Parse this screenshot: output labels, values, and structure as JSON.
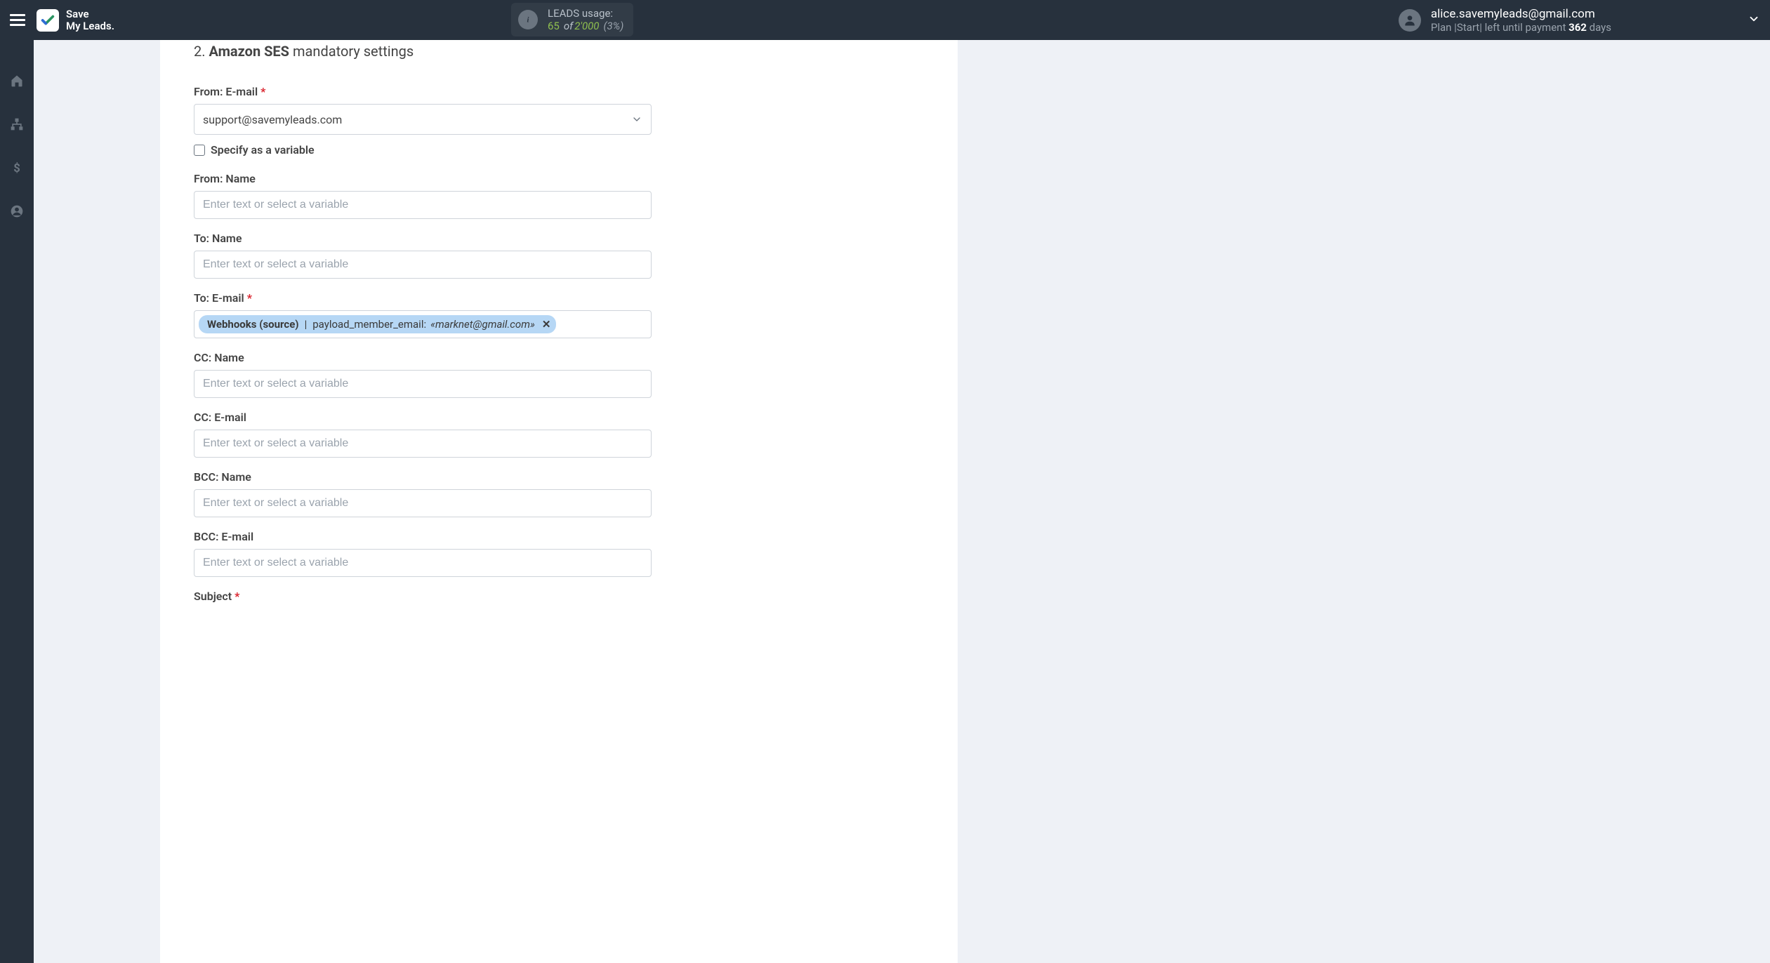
{
  "brand": {
    "line1": "Save",
    "line2": "My Leads."
  },
  "usage": {
    "label": "LEADS usage:",
    "used": "65",
    "of": "of",
    "total": "2'000",
    "pct": "(3%)"
  },
  "user": {
    "email": "alice.savemyleads@gmail.com",
    "plan_prefix": "Plan |",
    "plan_name": "Start",
    "plan_mid": "| left until payment ",
    "days": "362",
    "days_suffix": " days"
  },
  "section": {
    "num": "2.",
    "brand": "Amazon SES",
    "rest": "mandatory settings"
  },
  "labels": {
    "from_email": "From: E-mail",
    "specify_var": "Specify as a variable",
    "from_name": "From: Name",
    "to_name": "To: Name",
    "to_email": "To: E-mail",
    "cc_name": "CC: Name",
    "cc_email": "CC: E-mail",
    "bcc_name": "BCC: Name",
    "bcc_email": "BCC: E-mail",
    "subject": "Subject"
  },
  "values": {
    "from_email_selected": "support@savemyleads.com"
  },
  "chip": {
    "source": "Webhooks (source)",
    "sep": " | ",
    "field": "payload_member_email: ",
    "sample": "«marknet@gmail.com»",
    "x": "✕"
  },
  "placeholder": "Enter text or select a variable",
  "required_marker": "*"
}
